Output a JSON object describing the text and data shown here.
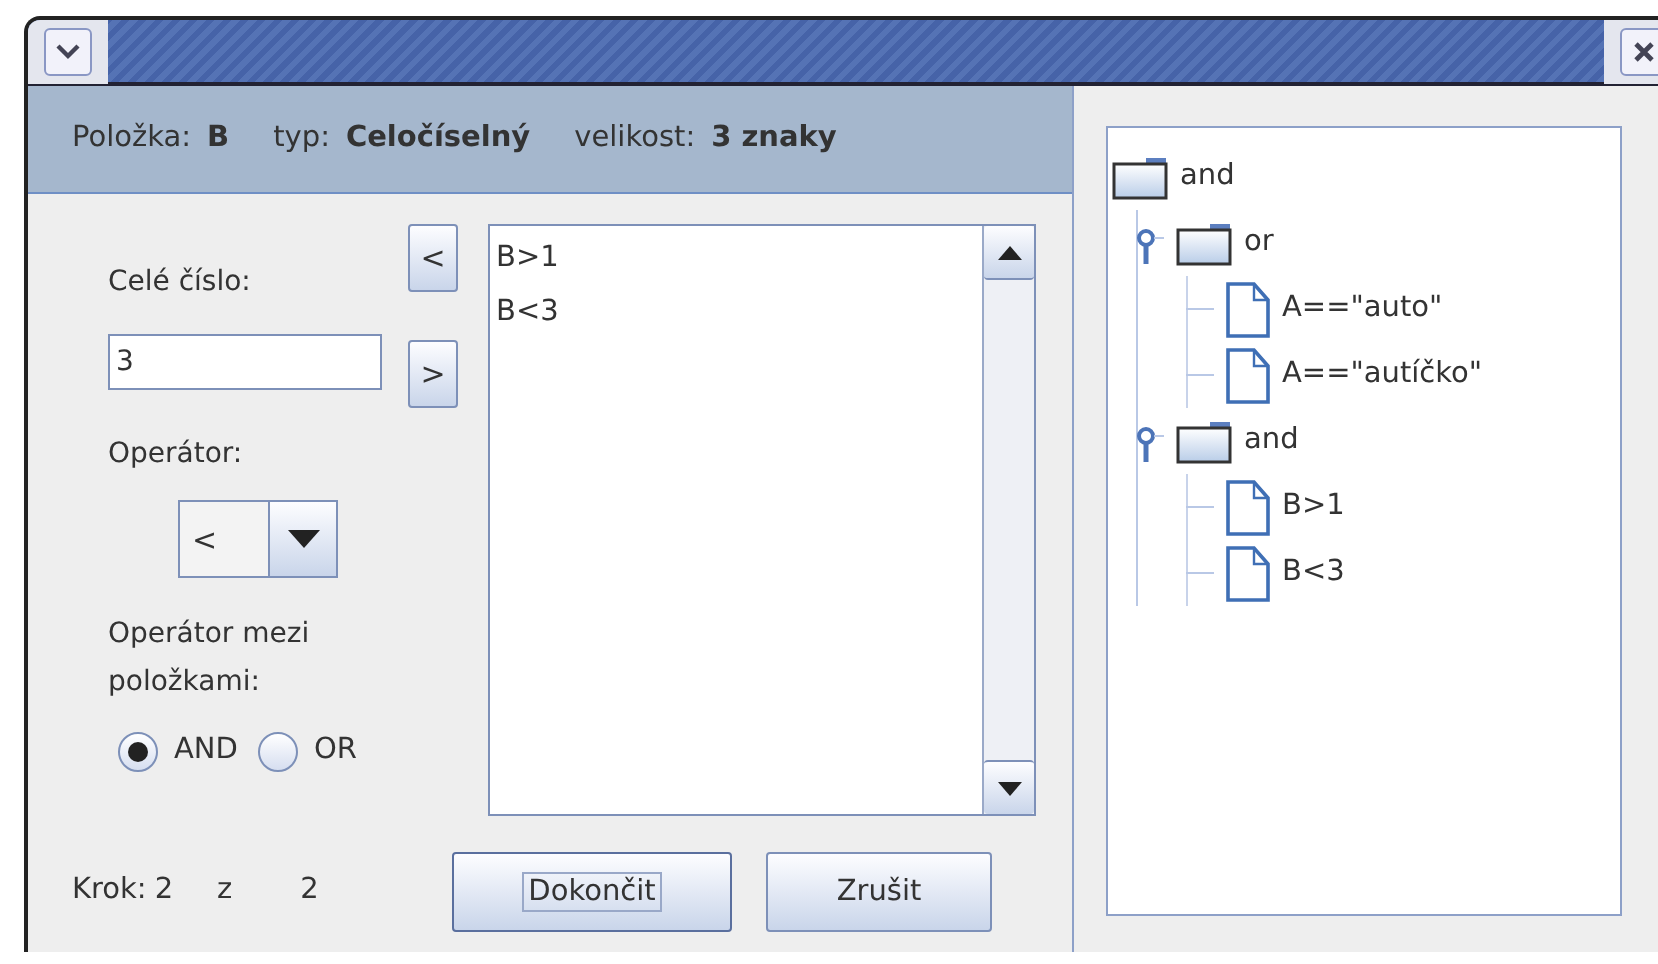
{
  "header": [
    {
      "label": "Položka:",
      "value": "B"
    },
    {
      "label": "typ:",
      "value": "Celočíselný"
    },
    {
      "label": "velikost:",
      "value": "3 znaky"
    }
  ],
  "number_label": "Celé číslo:",
  "number_field": {
    "value": "3"
  },
  "move_buttons": [
    "<",
    ">"
  ],
  "operator_label": "Operátor:",
  "operator_combo": {
    "value": "<"
  },
  "join_label": "Operátor mezi položkami:",
  "join_options": [
    {
      "label": "AND",
      "selected": true
    },
    {
      "label": "OR",
      "selected": false
    }
  ],
  "conditions": [
    "B>1",
    "B<3"
  ],
  "step": {
    "label": "Krok:",
    "current": "2",
    "of": "z",
    "total": "2"
  },
  "buttons": [
    {
      "label": "Dokončit",
      "focused": true
    },
    {
      "label": "Zrušit",
      "focused": false
    }
  ],
  "tree": [
    {
      "label": "and",
      "kind": "folder",
      "children": [
        {
          "label": "or",
          "kind": "folder",
          "expanded": true,
          "children": [
            {
              "label": "A==\"auto\"",
              "kind": "leaf"
            },
            {
              "label": "A==\"autíčko\"",
              "kind": "leaf"
            }
          ]
        },
        {
          "label": "and",
          "kind": "folder",
          "expanded": true,
          "children": [
            {
              "label": "B>1",
              "kind": "leaf"
            },
            {
              "label": "B<3",
              "kind": "leaf"
            }
          ]
        }
      ]
    }
  ]
}
